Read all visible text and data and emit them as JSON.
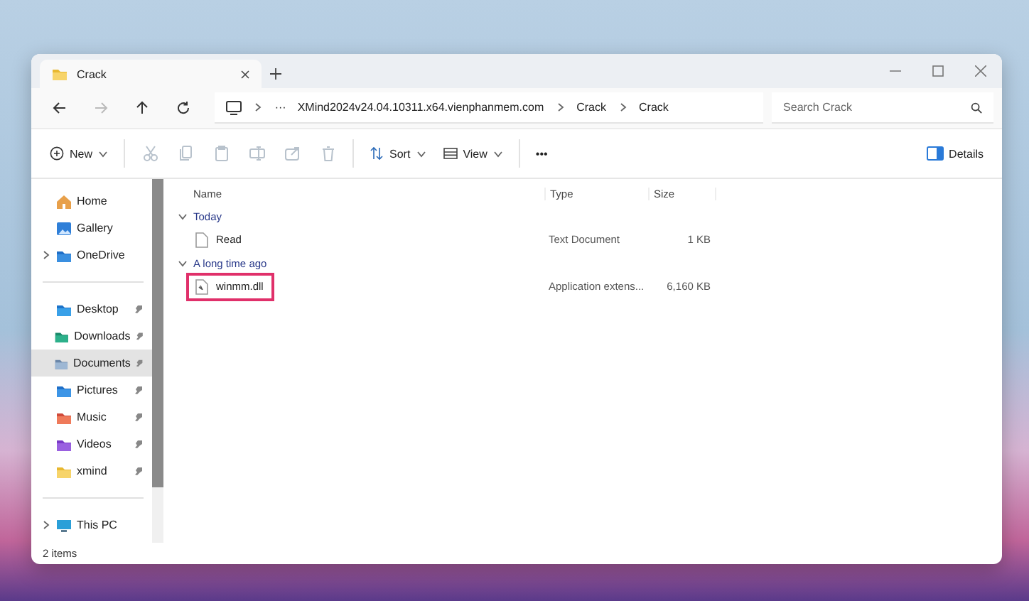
{
  "tab": {
    "title": "Crack"
  },
  "nav": {
    "back_disabled": false,
    "forward_disabled": true
  },
  "address": {
    "overflow": "···",
    "crumbs": [
      "XMind2024v24.04.10311.x64.vienphanmem.com",
      "Crack",
      "Crack"
    ]
  },
  "search": {
    "placeholder": "Search Crack"
  },
  "toolbar": {
    "new_label": "New",
    "icons": [
      {
        "disabled": true
      },
      {
        "disabled": true
      },
      {
        "disabled": true
      },
      {
        "disabled": true
      },
      {
        "disabled": true
      },
      {
        "disabled": true
      }
    ],
    "sort_label": "Sort",
    "view_label": "View",
    "more_label": "•••",
    "details_label": "Details"
  },
  "sidebar": {
    "sections": [
      [
        {
          "label": "Home",
          "pinned": false,
          "expandable": false,
          "selected": false
        },
        {
          "label": "Gallery",
          "pinned": false,
          "expandable": false,
          "selected": false
        },
        {
          "label": "OneDrive",
          "pinned": false,
          "expandable": true,
          "selected": false
        }
      ],
      [
        {
          "label": "Desktop",
          "pinned": true,
          "expandable": false,
          "selected": false
        },
        {
          "label": "Downloads",
          "pinned": true,
          "expandable": false,
          "selected": false
        },
        {
          "label": "Documents",
          "pinned": true,
          "expandable": false,
          "selected": true
        },
        {
          "label": "Pictures",
          "pinned": true,
          "expandable": false,
          "selected": false
        },
        {
          "label": "Music",
          "pinned": true,
          "expandable": false,
          "selected": false
        },
        {
          "label": "Videos",
          "pinned": true,
          "expandable": false,
          "selected": false
        },
        {
          "label": "xmind",
          "pinned": true,
          "expandable": false,
          "selected": false
        }
      ],
      [
        {
          "label": "This PC",
          "pinned": false,
          "expandable": true,
          "selected": false
        }
      ]
    ]
  },
  "table": {
    "columns": [
      "Name",
      "Type",
      "Size"
    ],
    "groups": [
      {
        "label": "Today",
        "expanded": true,
        "rows": [
          {
            "name": "Read",
            "type": "Text Document",
            "size": "1 KB",
            "highlighted": false
          }
        ]
      },
      {
        "label": "A long time ago",
        "expanded": true,
        "rows": [
          {
            "name": "winmm.dll",
            "type": "Application extens...",
            "size": "6,160 KB",
            "highlighted": true
          }
        ]
      }
    ]
  },
  "status_bar": {
    "text": "2 items"
  }
}
